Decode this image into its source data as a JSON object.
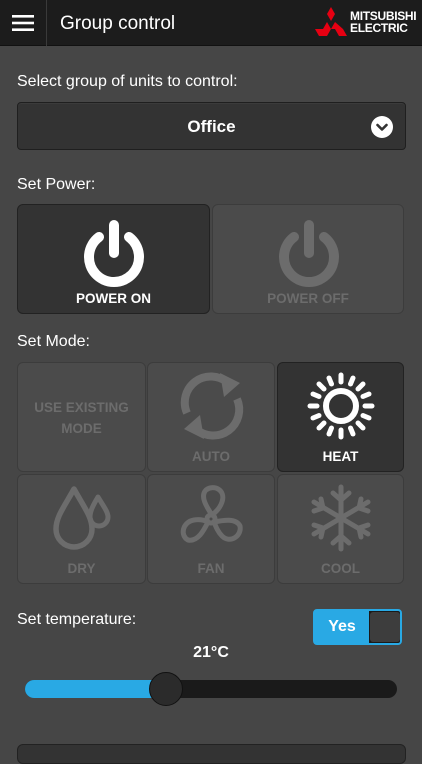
{
  "header": {
    "title": "Group control",
    "brand_line1": "MITSUBISHI",
    "brand_line2": "ELECTRIC",
    "icons": [
      "hamburger-menu-icon",
      "mitsubishi-diamonds-logo"
    ]
  },
  "group": {
    "label": "Select group of units to control:",
    "selected": "Office"
  },
  "power": {
    "label": "Set Power:",
    "on_label": "POWER ON",
    "off_label": "POWER OFF",
    "selected": "on"
  },
  "mode": {
    "label": "Set Mode:",
    "existing_label_line1": "USE EXISTING",
    "existing_label_line2": "MODE",
    "auto_label": "AUTO",
    "heat_label": "HEAT",
    "dry_label": "DRY",
    "fan_label": "FAN",
    "cool_label": "COOL",
    "selected": "heat"
  },
  "temperature": {
    "label": "Set temperature:",
    "toggle_label": "Yes",
    "value": "21°C",
    "slider_fraction": 0.38
  },
  "colors": {
    "accent": "#29a9e4",
    "brand_red": "#e60012",
    "background": "#464646",
    "header": "#1c1c1c"
  }
}
